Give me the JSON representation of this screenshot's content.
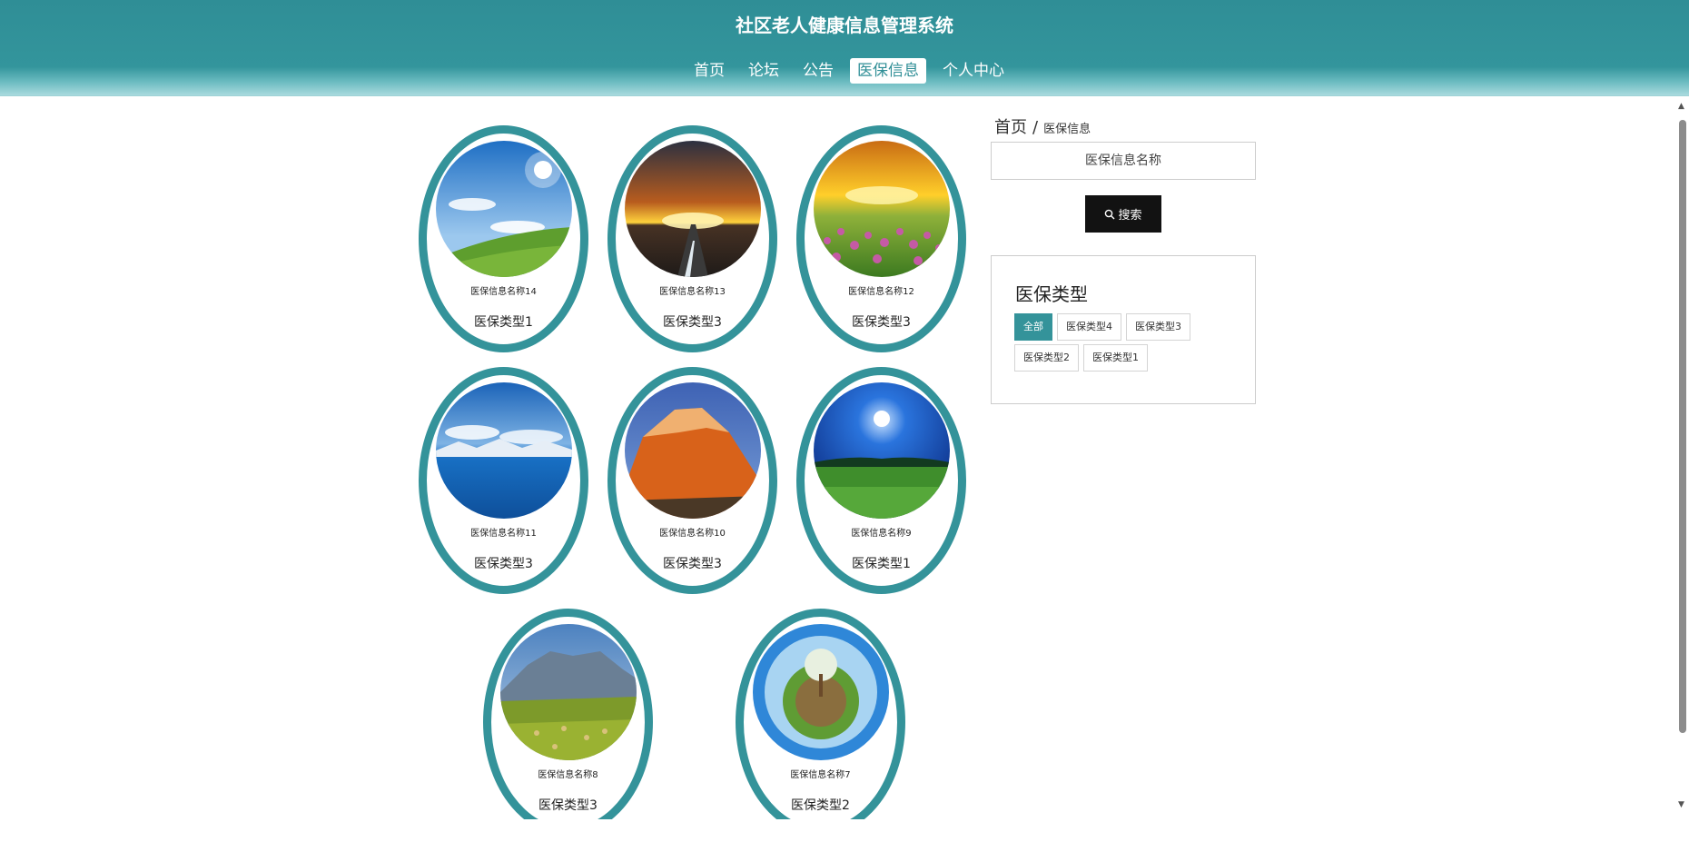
{
  "header": {
    "title": "社区老人健康信息管理系统",
    "nav": [
      "首页",
      "论坛",
      "公告",
      "医保信息",
      "个人中心"
    ],
    "active_nav": "医保信息"
  },
  "breadcrumb": {
    "home": "首页",
    "separator": "/",
    "current": "医保信息"
  },
  "search": {
    "placeholder": "医保信息名称",
    "button_label": "搜索",
    "button_icon": "search-icon"
  },
  "type_panel": {
    "title": "医保类型",
    "items": [
      "全部",
      "医保类型4",
      "医保类型3",
      "医保类型2",
      "医保类型1"
    ],
    "active": "全部"
  },
  "cards": [
    {
      "name": "医保信息名称14",
      "type": "医保类型1",
      "image": "sky-and-green-hill"
    },
    {
      "name": "医保信息名称13",
      "type": "医保类型3",
      "image": "sunset-road"
    },
    {
      "name": "医保信息名称12",
      "type": "医保类型3",
      "image": "sunset-flower-field"
    },
    {
      "name": "医保信息名称11",
      "type": "医保类型3",
      "image": "blue-lake-snow-mountains"
    },
    {
      "name": "医保信息名称10",
      "type": "医保类型3",
      "image": "orange-rock-mountain"
    },
    {
      "name": "医保信息名称9",
      "type": "医保类型1",
      "image": "night-sky-meadow"
    },
    {
      "name": "医保信息名称8",
      "type": "医保类型3",
      "image": "mountain-hay-field"
    },
    {
      "name": "医保信息名称7",
      "type": "医保类型2",
      "image": "tiny-planet"
    }
  ],
  "colors": {
    "theme": "#34939a",
    "header": "#2f8e96",
    "button": "#121212"
  }
}
